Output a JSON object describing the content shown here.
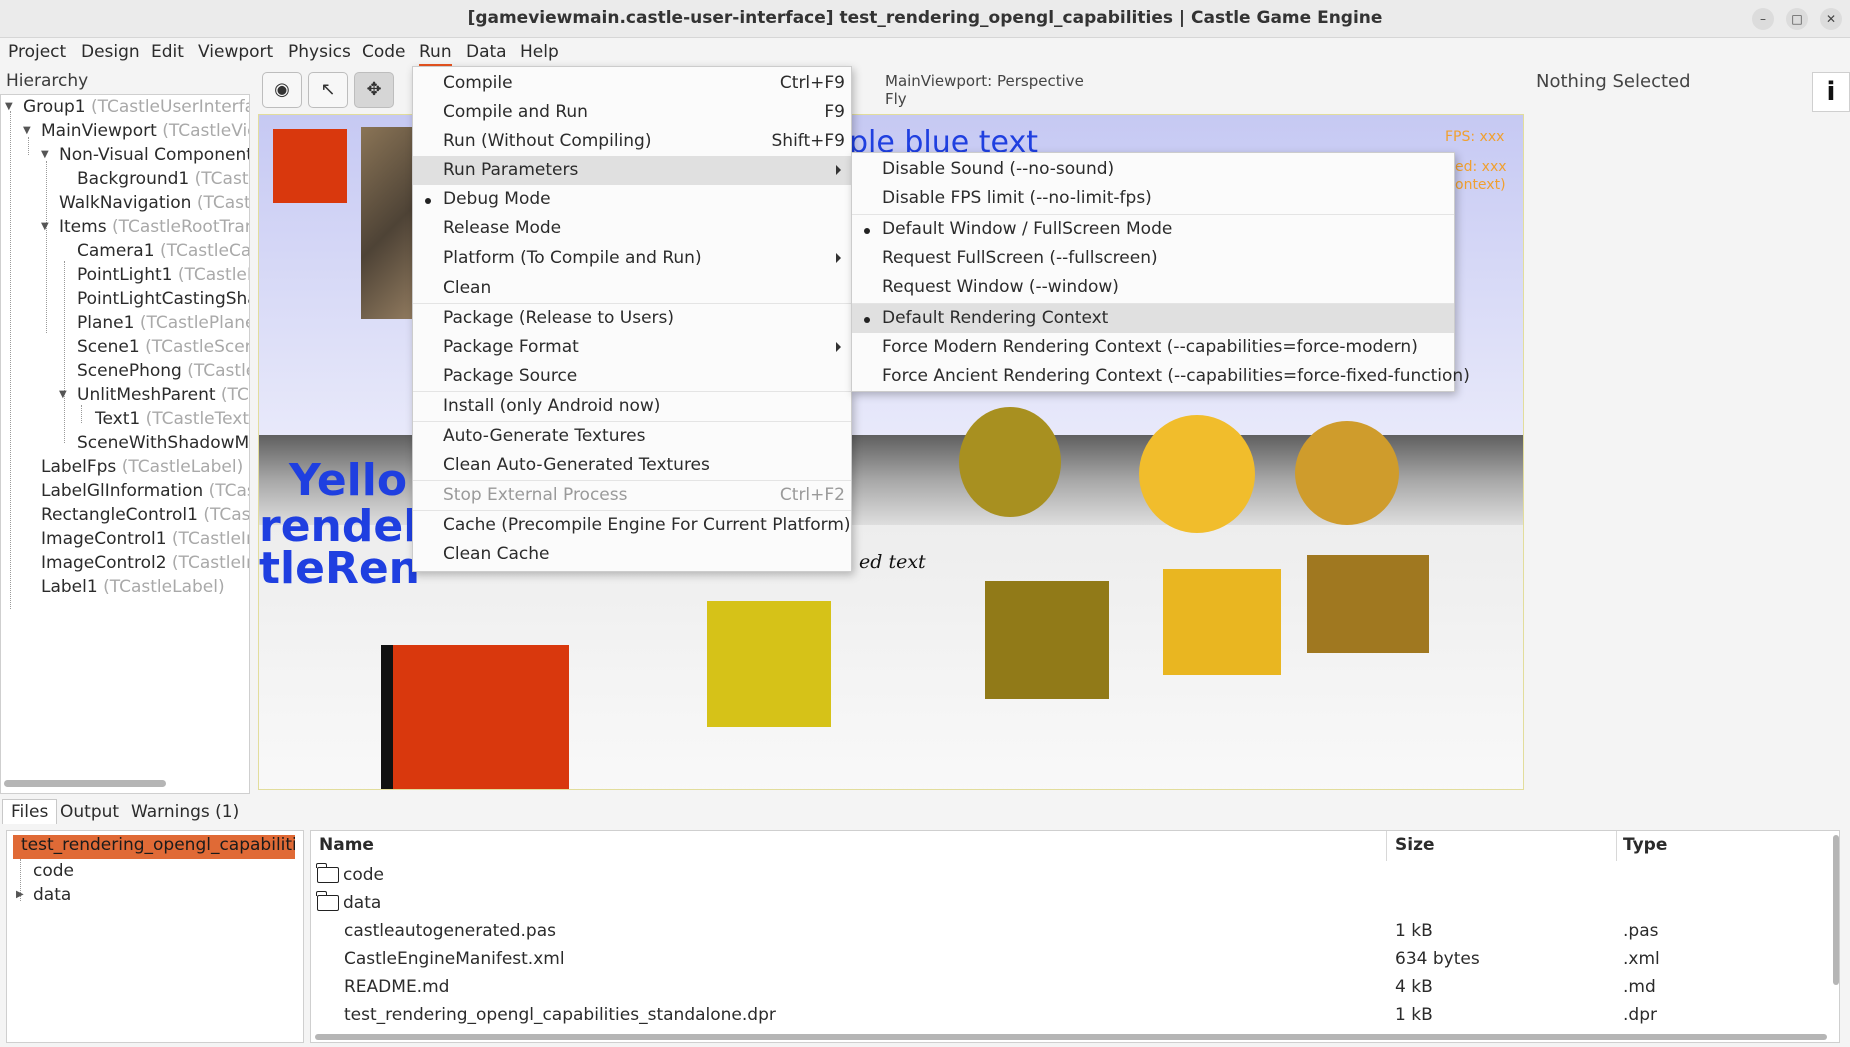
{
  "window": {
    "title": "[gameviewmain.castle-user-interface] test_rendering_opengl_capabilities | Castle Game Engine"
  },
  "menubar": [
    "Project",
    "Design",
    "Edit",
    "Viewport",
    "Physics",
    "Code",
    "Run",
    "Data",
    "Help"
  ],
  "hierarchy": {
    "title": "Hierarchy",
    "items": [
      {
        "name": "Group1",
        "cls": "(TCastleUserInterfa"
      },
      {
        "name": "MainViewport",
        "cls": "(TCastleVie"
      },
      {
        "name": "Non-Visual Components",
        "cls": ""
      },
      {
        "name": "Background1",
        "cls": "(TCastl"
      },
      {
        "name": "WalkNavigation",
        "cls": "(TCastl"
      },
      {
        "name": "Items",
        "cls": "(TCastleRootTran"
      },
      {
        "name": "Camera1",
        "cls": "(TCastleCar"
      },
      {
        "name": "PointLight1",
        "cls": "(TCastleP"
      },
      {
        "name": "PointLightCastingShad",
        "cls": ""
      },
      {
        "name": "Plane1",
        "cls": "(TCastlePlane"
      },
      {
        "name": "Scene1",
        "cls": "(TCastleScen"
      },
      {
        "name": "ScenePhong",
        "cls": "(TCastle"
      },
      {
        "name": "UnlitMeshParent",
        "cls": "(TC"
      },
      {
        "name": "Text1",
        "cls": "(TCastleText"
      },
      {
        "name": "SceneWithShadowMa",
        "cls": ""
      },
      {
        "name": "LabelFps",
        "cls": "(TCastleLabel)"
      },
      {
        "name": "LabelGlInformation",
        "cls": "(TCas"
      },
      {
        "name": "RectangleControl1",
        "cls": "(TCast"
      },
      {
        "name": "ImageControl1",
        "cls": "(TCastleIn"
      },
      {
        "name": "ImageControl2",
        "cls": "(TCastleIn"
      },
      {
        "name": "Label1",
        "cls": "(TCastleLabel)"
      }
    ]
  },
  "viewport": {
    "info_line1": "MainViewport: Perspective",
    "info_line2": "Fly",
    "fps_label": "FPS: xxx",
    "fps_label2": "ed: xxx",
    "fps_label3": "ontext)",
    "blue_text": "ple blue text",
    "yellow_text": "Yello",
    "rendering_text": "rendel",
    "castle_text": "tleRen",
    "scene_text": "ed text",
    "cube_color": "#d9380d"
  },
  "right_panel": {
    "nothing_selected": "Nothing Selected",
    "info_button": "i"
  },
  "run_menu": {
    "items": [
      {
        "label": "Compile",
        "shortcut": "Ctrl+F9"
      },
      {
        "label": "Compile and Run",
        "shortcut": "F9"
      },
      {
        "label": "Run (Without Compiling)",
        "shortcut": "Shift+F9"
      },
      {
        "label": "Run Parameters",
        "shortcut": ""
      },
      {
        "label": "Debug Mode",
        "shortcut": ""
      },
      {
        "label": "Release Mode",
        "shortcut": ""
      },
      {
        "label": "Platform (To Compile and Run)",
        "shortcut": ""
      },
      {
        "label": "Clean",
        "shortcut": ""
      },
      {
        "label": "Package (Release to Users)",
        "shortcut": ""
      },
      {
        "label": "Package Format",
        "shortcut": ""
      },
      {
        "label": "Package Source",
        "shortcut": ""
      },
      {
        "label": "Install (only Android now)",
        "shortcut": ""
      },
      {
        "label": "Auto-Generate Textures",
        "shortcut": ""
      },
      {
        "label": "Clean Auto-Generated Textures",
        "shortcut": ""
      },
      {
        "label": "Stop External Process",
        "shortcut": "Ctrl+F2"
      },
      {
        "label": "Cache (Precompile Engine For Current Platform)",
        "shortcut": ""
      },
      {
        "label": "Clean Cache",
        "shortcut": ""
      }
    ]
  },
  "run_params_menu": {
    "items": [
      {
        "label": "Disable Sound (--no-sound)"
      },
      {
        "label": "Disable FPS limit (--no-limit-fps)"
      },
      {
        "label": "Default Window / FullScreen Mode"
      },
      {
        "label": "Request FullScreen (--fullscreen)"
      },
      {
        "label": "Request Window (--window)"
      },
      {
        "label": "Default Rendering Context"
      },
      {
        "label": "Force Modern Rendering Context (--capabilities=force-modern)"
      },
      {
        "label": "Force Ancient Rendering Context (--capabilities=force-fixed-function)"
      }
    ]
  },
  "bottom_tabs": [
    "Files",
    "Output",
    "Warnings (1)"
  ],
  "files_tree": {
    "project": "test_rendering_opengl_capabilities",
    "children": [
      "code",
      "data"
    ]
  },
  "file_table": {
    "headers": [
      "Name",
      "Size",
      "Type"
    ],
    "rows": [
      {
        "name": "code",
        "size": "",
        "type": ""
      },
      {
        "name": "data",
        "size": "",
        "type": ""
      },
      {
        "name": "castleautogenerated.pas",
        "size": "1 kB",
        "type": ".pas"
      },
      {
        "name": "CastleEngineManifest.xml",
        "size": "634 bytes",
        "type": ".xml"
      },
      {
        "name": "README.md",
        "size": "4 kB",
        "type": ".md"
      },
      {
        "name": "test_rendering_opengl_capabilities_standalone.dpr",
        "size": "1 kB",
        "type": ".dpr"
      }
    ]
  }
}
